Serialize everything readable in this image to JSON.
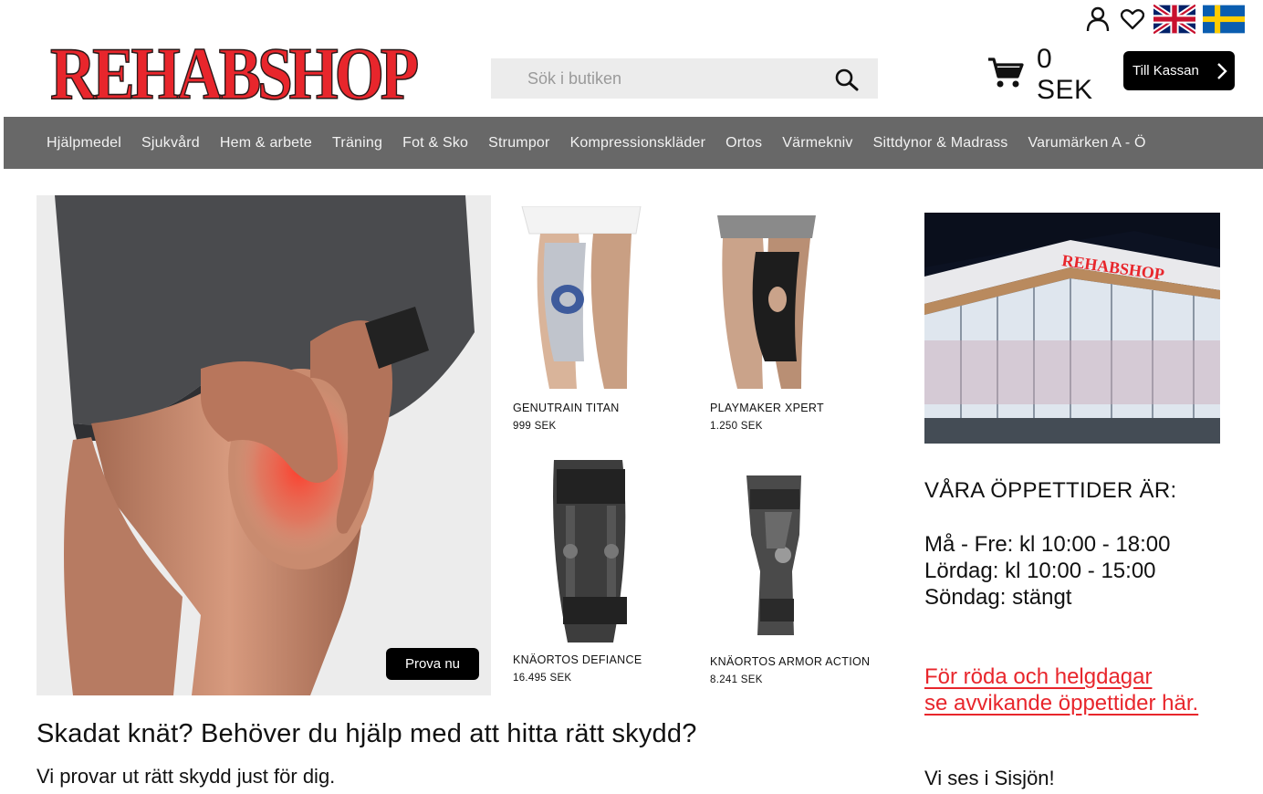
{
  "header": {
    "logo_text": "REHABSHOP",
    "search": {
      "placeholder": "Sök i butiken"
    },
    "cart": {
      "total": "0 SEK"
    },
    "checkout_label": "Till Kassan"
  },
  "nav": {
    "items": [
      "Hjälpmedel",
      "Sjukvård",
      "Hem & arbete",
      "Träning",
      "Fot & Sko",
      "Strumpor",
      "Kompressionskläder",
      "Ortos",
      "Värmekniv",
      "Sittdynor & Madrass",
      "Varumärken A - Ö"
    ]
  },
  "hero": {
    "cta_label": "Prova nu",
    "headline": "Skadat knät? Behöver du hjälp med att hitta rätt skydd?",
    "subline": "Vi provar ut rätt skydd just för dig."
  },
  "products": [
    {
      "name": "GENUTRAIN TITAN",
      "price": "999 SEK"
    },
    {
      "name": "PLAYMAKER XPERT",
      "price": "1.250 SEK"
    },
    {
      "name": "KNÄORTOS DEFIANCE",
      "price": "16.495 SEK"
    },
    {
      "name": "KNÄORTOS ARMOR ACTION",
      "price": "8.241 SEK"
    }
  ],
  "store": {
    "sign_text": "REHABSHOP",
    "hours_title": "VÅRA ÖPPETTIDER ÄR:",
    "hours": [
      "Må - Fre: kl 10:00 - 18:00",
      "Lördag: kl 10:00 - 15:00",
      "Söndag: stängt"
    ],
    "holiday_link": [
      "För röda och helgdagar",
      "se avvikande öppettider här."
    ],
    "see_you": "Vi ses i Sisjön!"
  },
  "colors": {
    "brand_red": "#e8262c",
    "nav_bg": "#686868",
    "button_bg": "#000000"
  }
}
